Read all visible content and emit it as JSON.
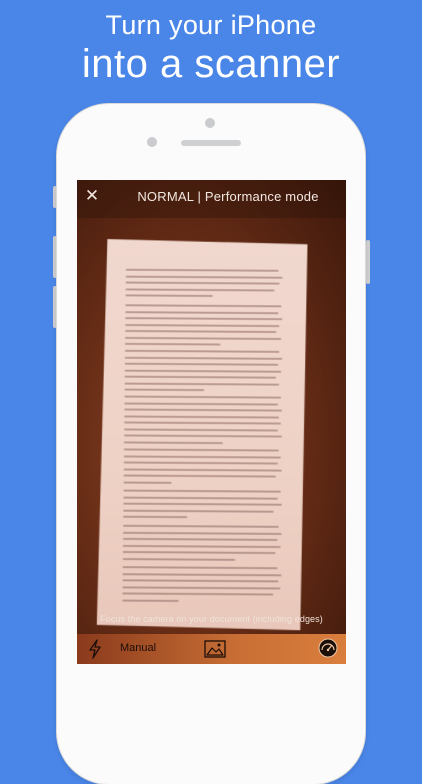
{
  "headline": {
    "line1": "Turn your iPhone",
    "line2": "into a scanner"
  },
  "camera": {
    "mode_title": "NORMAL | Performance mode",
    "close_icon": "close-icon",
    "hint": "Focus the camera on your document (including edges)",
    "bottom_bar": {
      "flash_icon": "flash-icon",
      "capture_mode": "Manual",
      "gallery_icon": "gallery-icon",
      "speed_icon": "speedometer-icon"
    }
  },
  "colors": {
    "background": "#4a86e8",
    "bottom_bar": "#d97e3d",
    "phone": "#fbfbfb"
  }
}
